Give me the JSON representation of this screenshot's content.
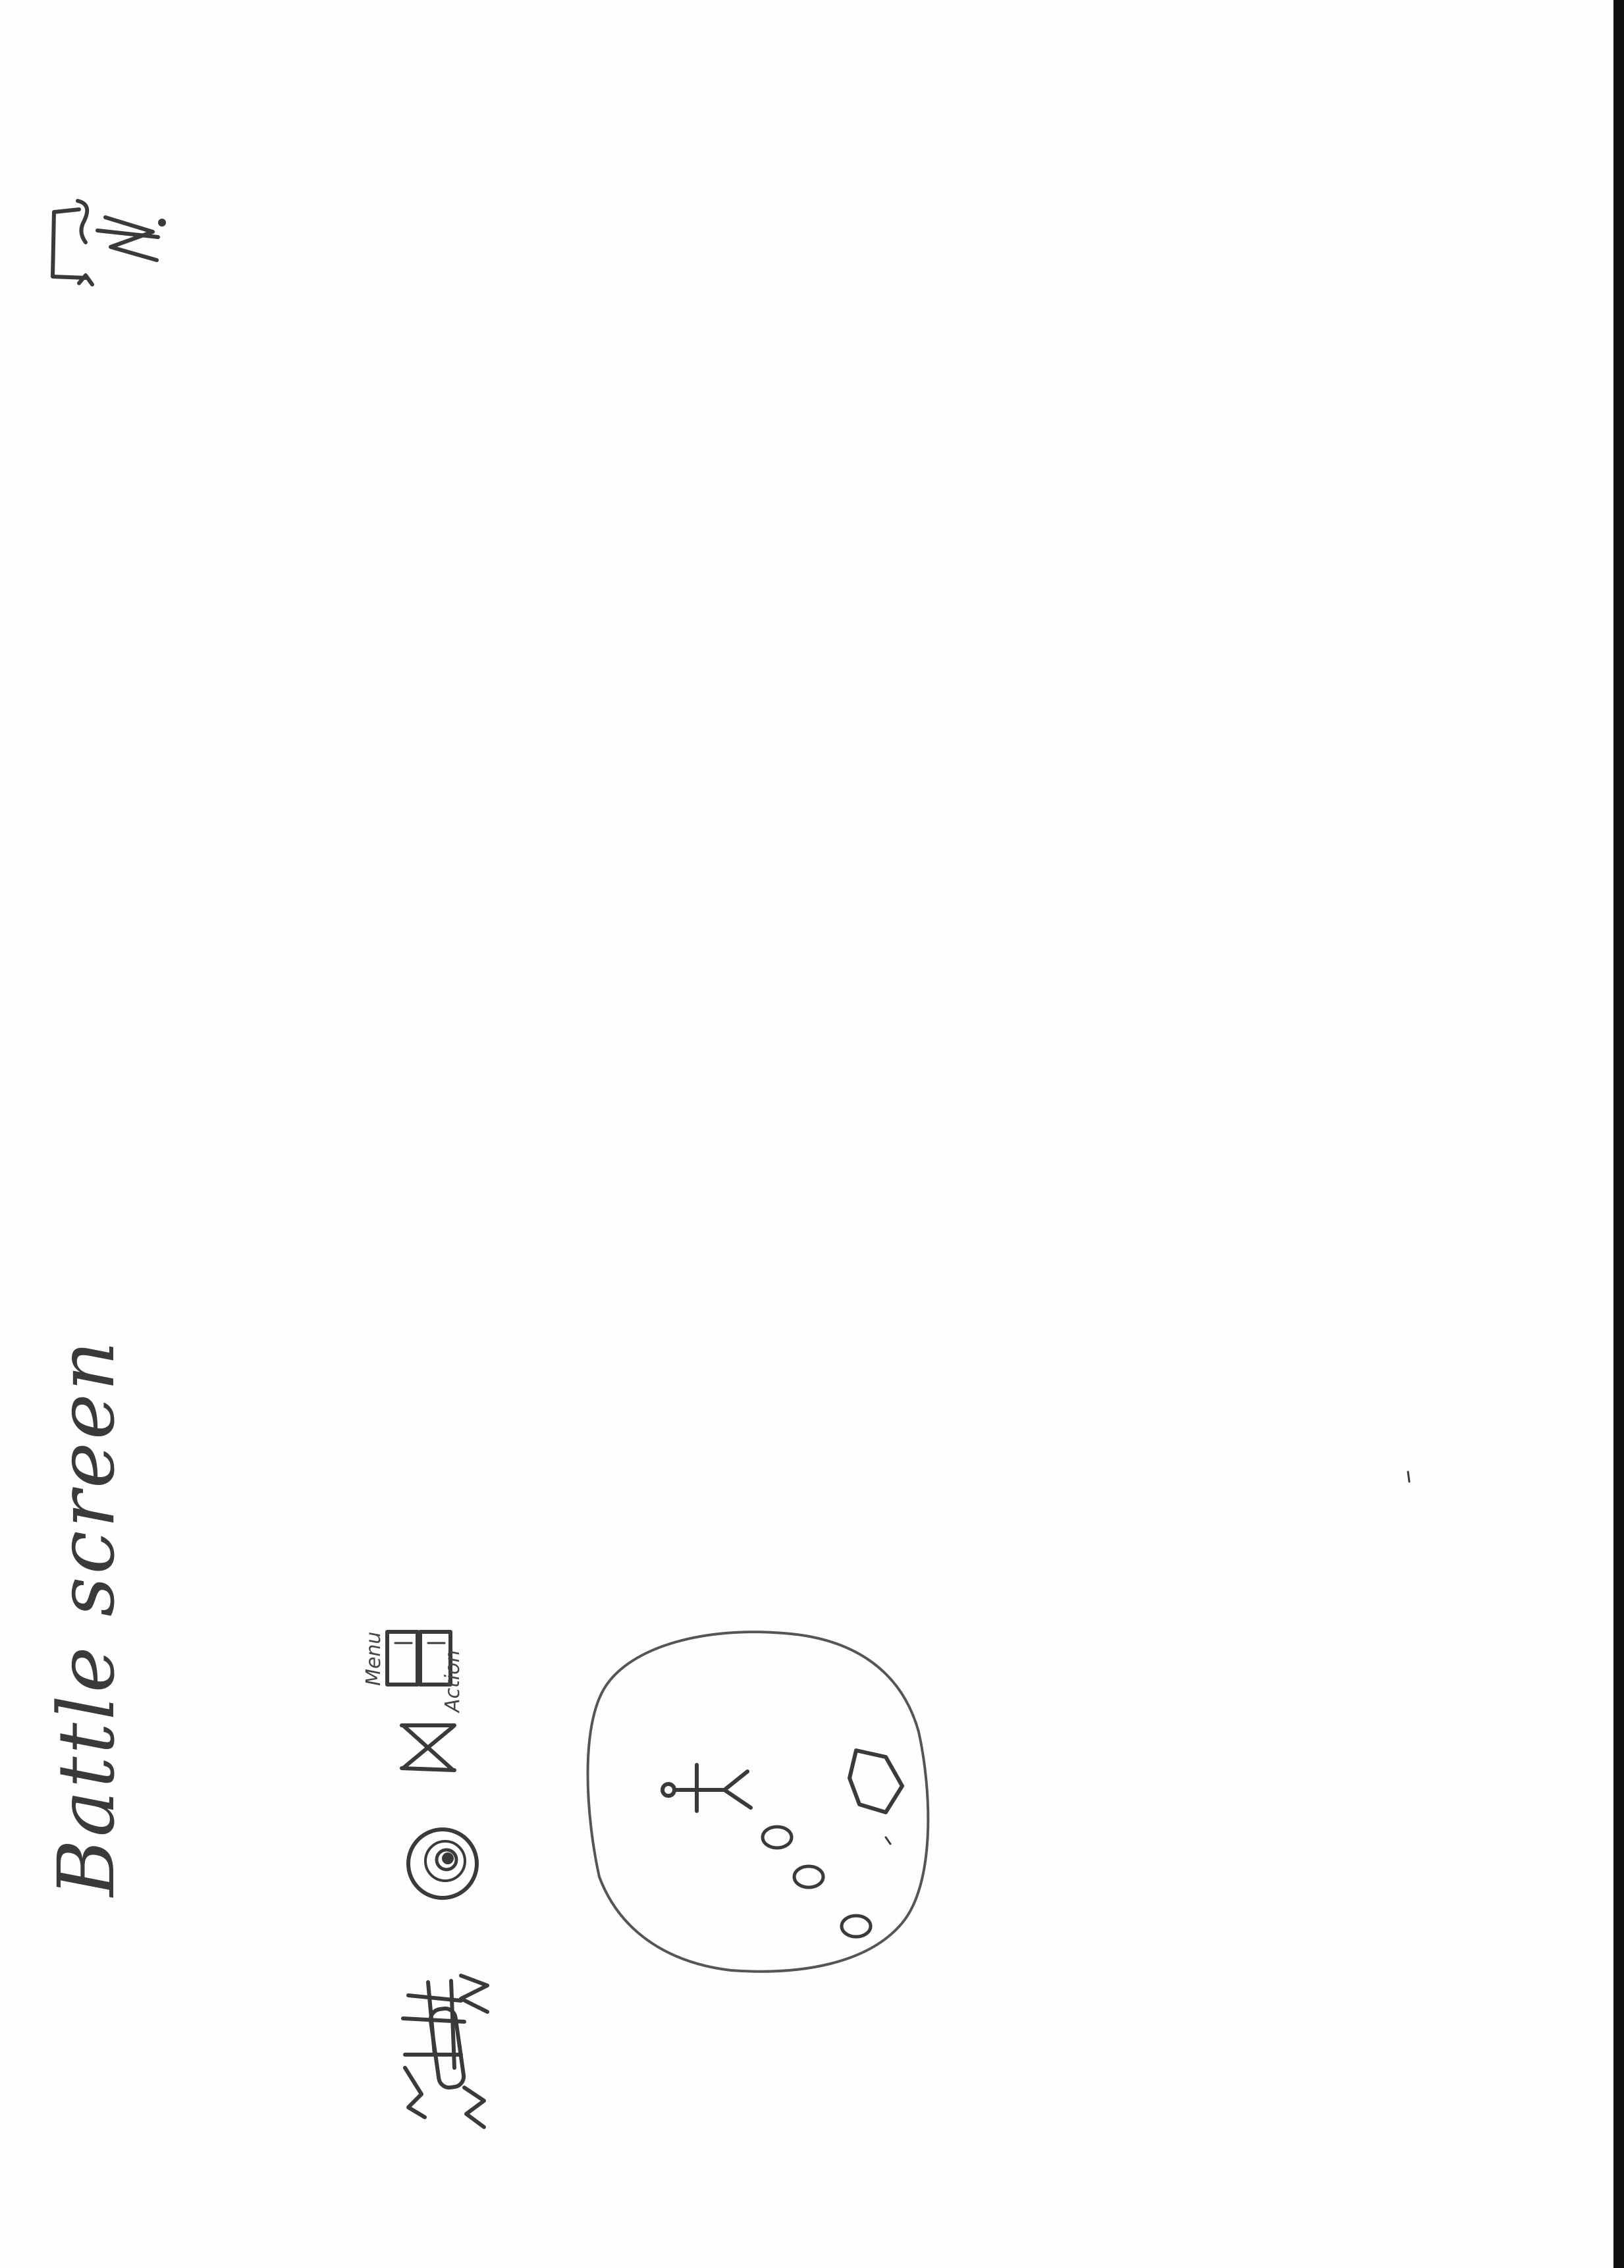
{
  "screen_title": "Battle screen",
  "toolbar": {
    "menu_label": "Menu",
    "action_label": "Action"
  },
  "stroke_color": "#3a3a3a",
  "icons": {
    "corner_mark": "corner-arrow-icon",
    "menu_sticks": "menu-hatch-icon",
    "target": "target-icon",
    "hourglass": "hourglass-icon",
    "menu_action": "menu-action-buttons-icon",
    "battle_arena": "arena-circle",
    "player": "stick-figure-icon",
    "enemy": "pentagon-icon",
    "steps": "footprint-icon"
  }
}
